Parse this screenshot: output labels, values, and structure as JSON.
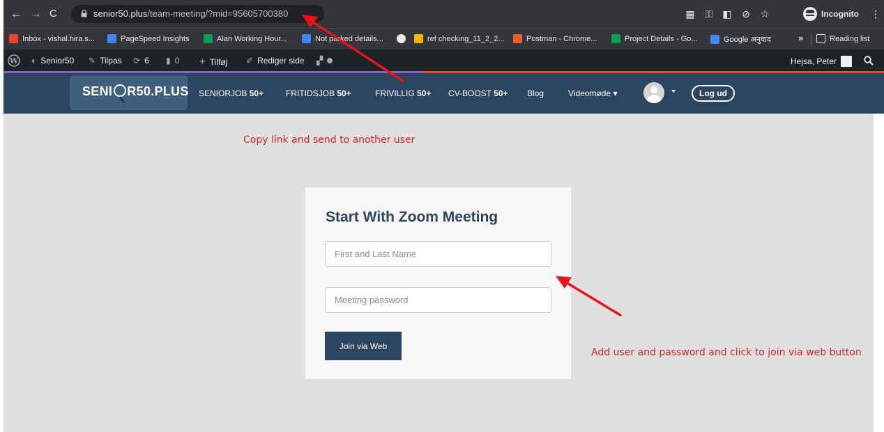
{
  "browser": {
    "url_host": "senior50.plus",
    "url_path": "/team-meeting/?mid=95605700380",
    "incognito_label": "Incognito",
    "icons": [
      "back-icon",
      "forward-icon",
      "reload-icon",
      "lock-icon",
      "qr-icon",
      "key-icon",
      "translate-icon",
      "eye-off-icon",
      "star-icon",
      "incognito-icon",
      "more-icon"
    ]
  },
  "bookmarks": {
    "items": [
      {
        "label": "Inbox - vishal.hira.s...",
        "color": "#ea4335"
      },
      {
        "label": "PageSpeed Insights",
        "color": "#4285f4"
      },
      {
        "label": "Alan Working Hour...",
        "color": "#0f9d58"
      },
      {
        "label": "Not parked details...",
        "color": "#4285f4"
      },
      {
        "label": "",
        "color": "#e8eaed"
      },
      {
        "label": "ref checking_11_2_2...",
        "color": "#f4b400"
      },
      {
        "label": "Postman - Chrome...",
        "color": "#ef5b25"
      },
      {
        "label": "Project Details - Go...",
        "color": "#0f9d58"
      },
      {
        "label": "Google अनुवाद",
        "color": "#4285f4"
      }
    ],
    "more": "»",
    "reading_list": "Reading list"
  },
  "wp_admin": {
    "site": "Senior50",
    "customize": "Tilpas",
    "updates": "6",
    "comments": "0",
    "new": "Tilføj",
    "edit": "Rediger side",
    "greeting": "Hejsa, Peter"
  },
  "site_nav": {
    "logo_left": "SENI",
    "logo_right": "R50.PLUS",
    "items": [
      {
        "label": "SENIORJOB",
        "suffix": "50+"
      },
      {
        "label": "FRITIDSJOB",
        "suffix": "50+"
      },
      {
        "label": "FRIVILLIG",
        "suffix": "50+"
      },
      {
        "label": "CV-BOOST",
        "suffix": "50+"
      },
      {
        "label": "Blog",
        "suffix": ""
      },
      {
        "label": "Videomøde ▾",
        "suffix": ""
      }
    ],
    "logout": "Log ud",
    "colors": {
      "nav_bg": "#2c4560",
      "logo_bg": "#3f5f7f"
    }
  },
  "annotations": {
    "copy_link": "Copy link and send to another user",
    "add_user": "Add user and password and click to join via web button",
    "color": "#e02020"
  },
  "form": {
    "title": "Start With Zoom Meeting",
    "name_placeholder": "First and Last Name",
    "password_placeholder": "Meeting password",
    "join_label": "Join via Web"
  }
}
